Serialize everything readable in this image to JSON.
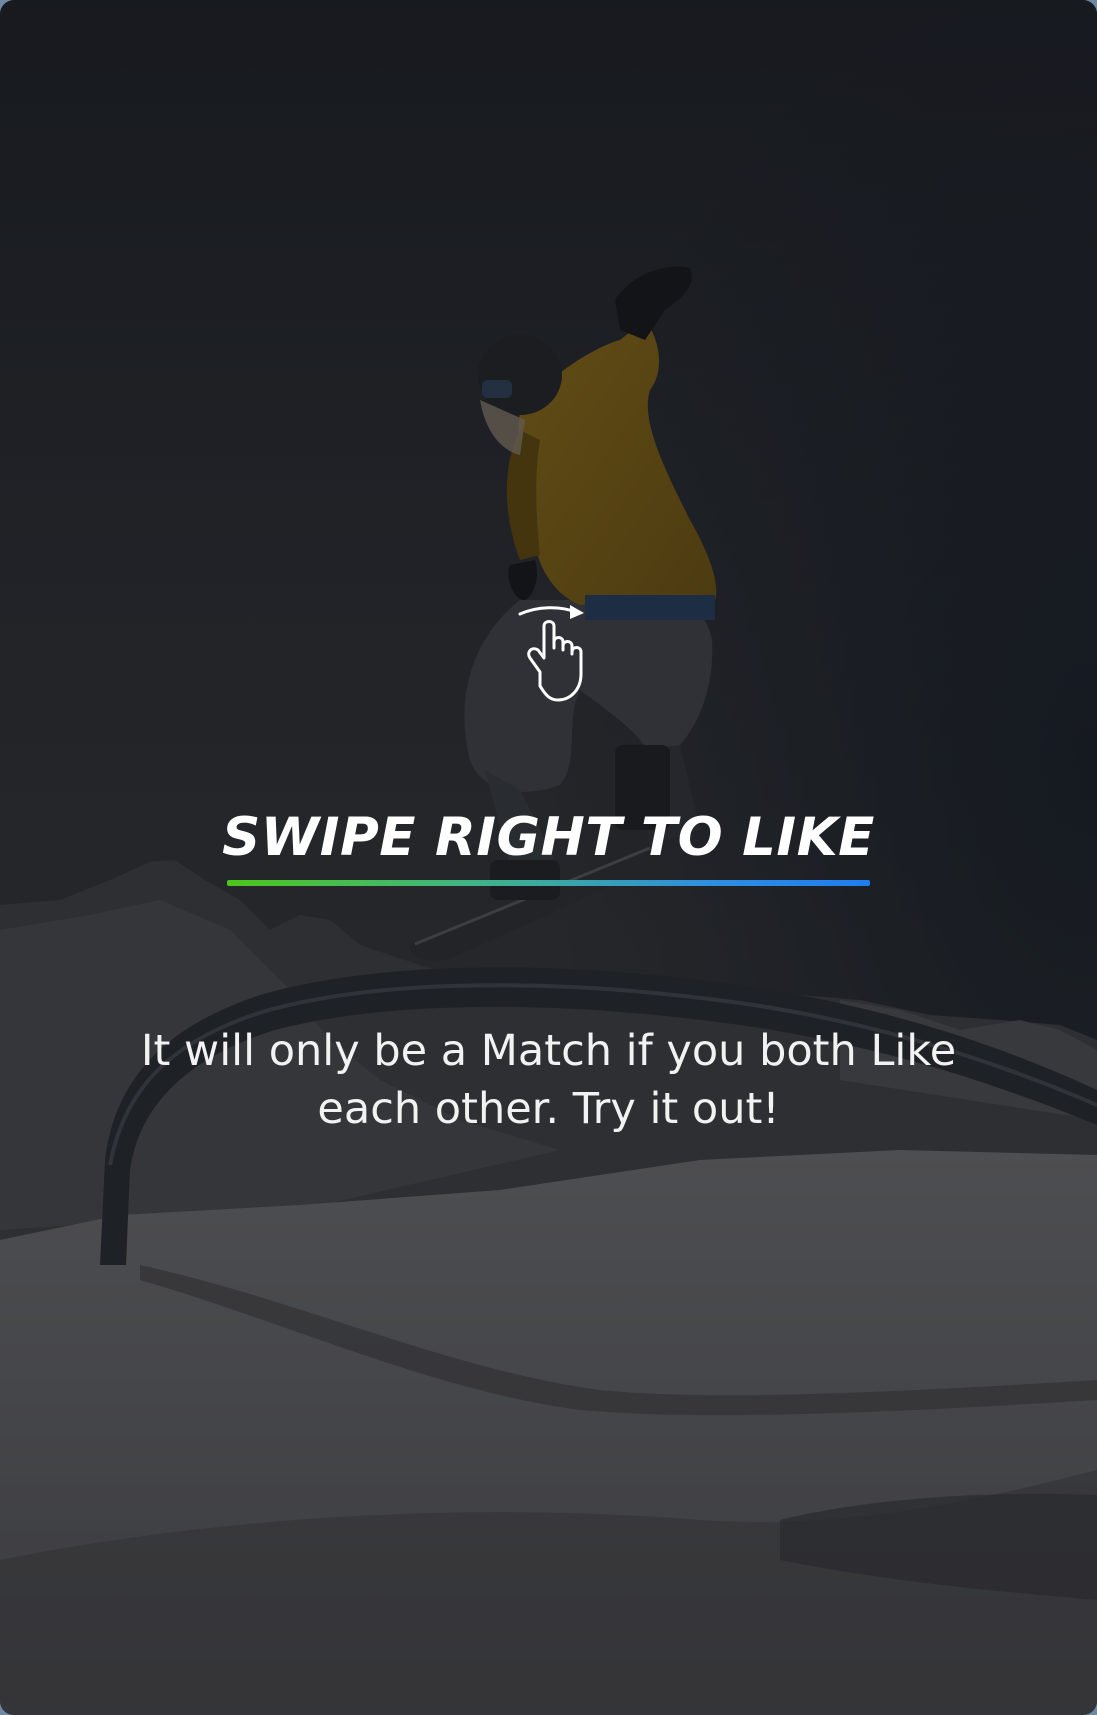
{
  "onboarding": {
    "headline": "SWIPE RIGHT TO LIKE",
    "description": "It will only be a Match if you both Like each other. Try it out!",
    "gesture_icon": "swipe-right-hand-icon",
    "underline_colors": [
      "#4cc51c",
      "#1f7cf0"
    ]
  }
}
